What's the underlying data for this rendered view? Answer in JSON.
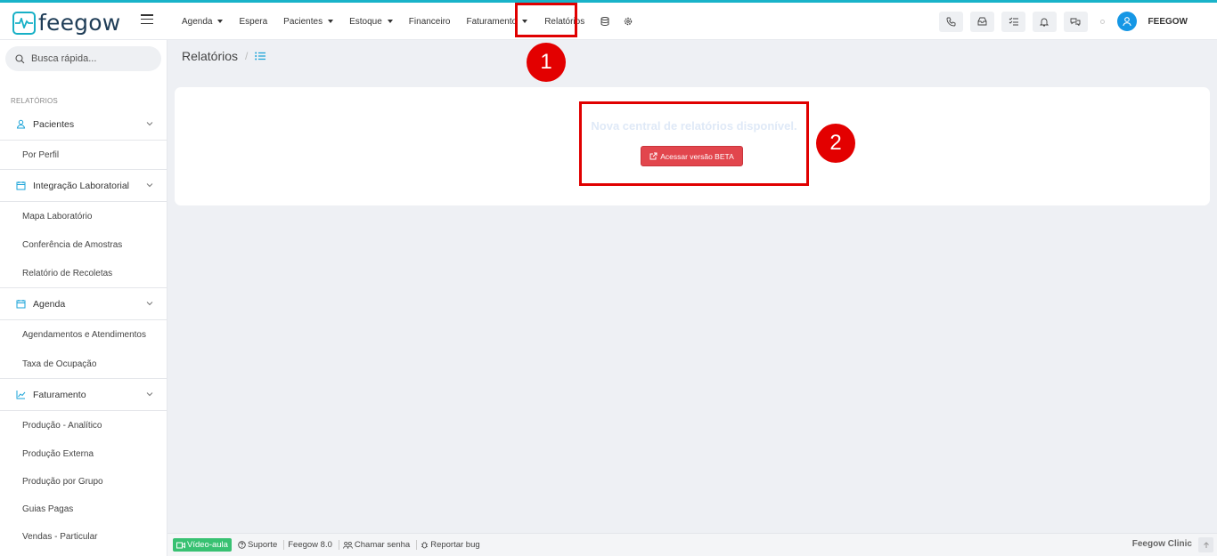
{
  "app": {
    "logo_text": "feegow",
    "brand_color": "#17b0c6"
  },
  "nav": {
    "items": [
      {
        "label": "Agenda",
        "dropdown": true
      },
      {
        "label": "Espera",
        "dropdown": false
      },
      {
        "label": "Pacientes",
        "dropdown": true
      },
      {
        "label": "Estoque",
        "dropdown": true
      },
      {
        "label": "Financeiro",
        "dropdown": false
      },
      {
        "label": "Faturamento",
        "dropdown": true
      },
      {
        "label": "Relatórios",
        "dropdown": false
      }
    ],
    "icons": [
      "database-icon",
      "gear-icon"
    ]
  },
  "header_right": {
    "icons": [
      "phone-icon",
      "inbox-icon",
      "checklist-icon",
      "bell-icon",
      "chat-icon"
    ],
    "user_name": "FEEGOW"
  },
  "sidebar": {
    "search_placeholder": "Busca rápida...",
    "section_label": "RELATÓRIOS",
    "groups": [
      {
        "label": "Pacientes",
        "icon": "user-icon",
        "items": [
          "Por Perfil"
        ]
      },
      {
        "label": "Integração Laboratorial",
        "icon": "calendar-icon",
        "items": [
          "Mapa Laboratório",
          "Conferência de Amostras",
          "Relatório de Recoletas"
        ]
      },
      {
        "label": "Agenda",
        "icon": "calendar-icon",
        "items": [
          "Agendamentos e Atendimentos",
          "Taxa de Ocupação"
        ]
      },
      {
        "label": "Faturamento",
        "icon": "chart-icon",
        "items": [
          "Produção - Analítico",
          "Produção Externa",
          "Produção por Grupo",
          "Guias Pagas",
          "Vendas - Particular"
        ]
      }
    ]
  },
  "breadcrumb": {
    "title": "Relatórios",
    "separator": "/"
  },
  "main": {
    "beta_message": "Nova central de relatórios disponível.",
    "beta_button": "Acessar versão BETA",
    "button_color": "#e2464d"
  },
  "annotations": {
    "badge_1": "1",
    "badge_2": "2",
    "highlight_color": "#e00000"
  },
  "footer": {
    "video_label": "Vídeo-aula",
    "support_label": "Suporte",
    "version_label": "Feegow 8.0",
    "call_label": "Chamar senha",
    "bug_label": "Reportar bug",
    "product_label": "Feegow Clinic"
  }
}
